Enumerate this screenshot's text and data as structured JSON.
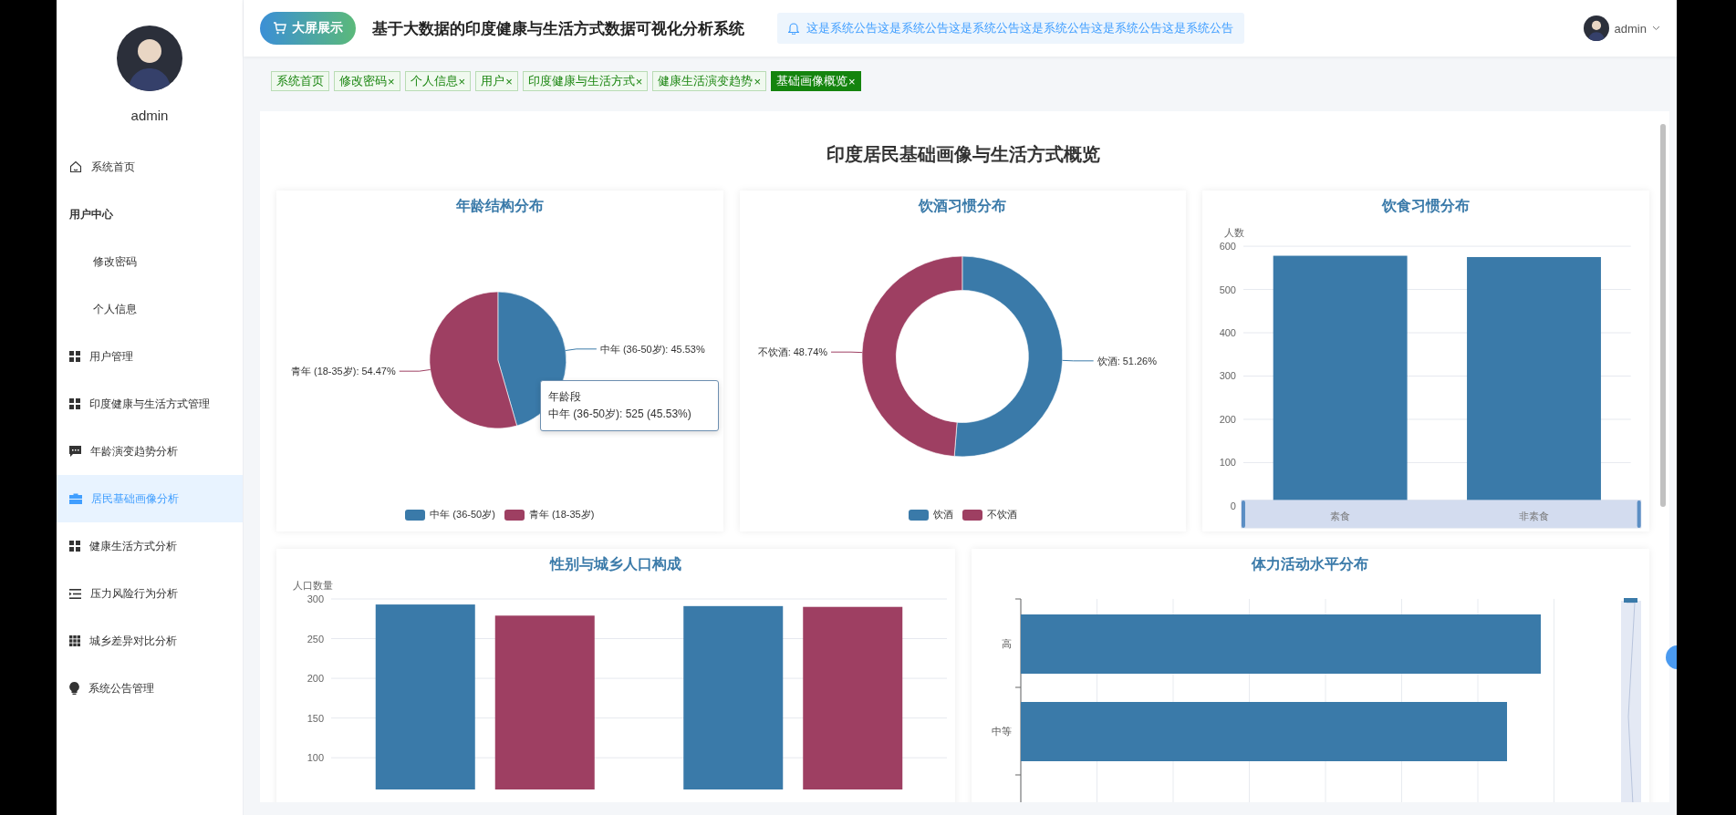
{
  "sidebar": {
    "username": "admin",
    "items": [
      {
        "label": "系统首页",
        "kind": "link",
        "selected": false
      },
      {
        "label": "用户中心",
        "kind": "group",
        "selected": false
      },
      {
        "label": "修改密码",
        "kind": "sub",
        "selected": false
      },
      {
        "label": "个人信息",
        "kind": "sub",
        "selected": false
      },
      {
        "label": "用户管理",
        "kind": "link",
        "selected": false
      },
      {
        "label": "印度健康与生活方式管理",
        "kind": "link",
        "selected": false
      },
      {
        "label": "年龄演变趋势分析",
        "kind": "link",
        "selected": false
      },
      {
        "label": "居民基础画像分析",
        "kind": "link",
        "selected": true
      },
      {
        "label": "健康生活方式分析",
        "kind": "link",
        "selected": false
      },
      {
        "label": "压力风险行为分析",
        "kind": "link",
        "selected": false
      },
      {
        "label": "城乡差异对比分析",
        "kind": "link",
        "selected": false
      },
      {
        "label": "系统公告管理",
        "kind": "link",
        "selected": false
      }
    ]
  },
  "header": {
    "screen_button": "大屏展示",
    "title": "基于大数据的印度健康与生活方式数据可视化分析系统",
    "notice": "这是系统公告这是系统公告这是系统公告这是系统公告这是系统公告这是系统公告",
    "user": "admin"
  },
  "tabs": [
    {
      "label": "系统首页",
      "selected": false
    },
    {
      "label": "修改密码",
      "close": "×",
      "selected": false
    },
    {
      "label": "个人信息",
      "close": "×",
      "selected": false
    },
    {
      "label": "用户",
      "close": "×",
      "selected": false
    },
    {
      "label": "印度健康与生活方式",
      "close": "×",
      "selected": false
    },
    {
      "label": "健康生活演变趋势",
      "close": "×",
      "selected": false
    },
    {
      "label": "基础画像概览",
      "close": "×",
      "selected": true
    }
  ],
  "page_title": "印度居民基础画像与生活方式概览",
  "age_chart": {
    "chart_data": {
      "type": "pie",
      "title": "年龄结构分布",
      "categories": [
        "中年 (36-50岁)",
        "青年 (18-35岁)"
      ],
      "values": [
        45.53,
        54.47
      ],
      "value_labels": [
        "中年 (36-50岁): 45.53%",
        "青年 (18-35岁): 54.47%"
      ]
    },
    "tooltip": {
      "title": "年龄段",
      "text": "中年 (36-50岁): 525 (45.53%)"
    }
  },
  "drinking_chart": {
    "chart_data": {
      "type": "donut",
      "title": "饮酒习惯分布",
      "categories": [
        "饮酒",
        "不饮酒"
      ],
      "values": [
        51.26,
        48.74
      ],
      "value_labels": [
        "饮酒: 51.26%",
        "不饮酒: 48.74%"
      ]
    }
  },
  "diet_chart": {
    "chart_data": {
      "type": "bar",
      "title": "饮食习惯分布",
      "ylabel": "人数",
      "categories": [
        "素食",
        "非素食"
      ],
      "values": [
        578,
        575
      ],
      "ylim": [
        0,
        600
      ],
      "yticks": [
        0,
        100,
        200,
        300,
        400,
        500,
        600
      ],
      "grid": true
    },
    "zoom": {
      "level": 1
    }
  },
  "gender_chart": {
    "chart_data": {
      "type": "bar",
      "title": "性别与城乡人口构成",
      "ylabel": "人口数量",
      "ylim": [
        60,
        300
      ],
      "yticks": [
        100,
        150,
        200,
        250,
        300
      ],
      "grid": true,
      "stacked": false,
      "series": [
        {
          "color": "#3a7aa9",
          "values": [
            293,
            291
          ]
        },
        {
          "color": "#9e3f62",
          "values": [
            279,
            290
          ]
        }
      ]
    }
  },
  "activity_chart": {
    "title": "体力活动水平分布",
    "categories": [
      "高",
      "中等"
    ],
    "zoom": {
      "level": 1
    }
  }
}
